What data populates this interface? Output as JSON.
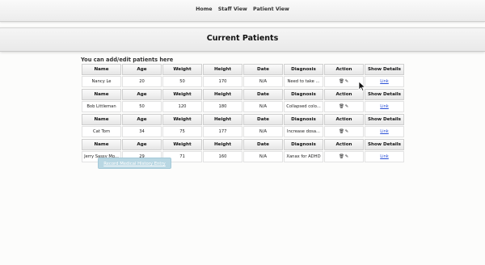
{
  "nav": {
    "home": "Home",
    "staff_view": "Staff View",
    "patient_view": "Patient View"
  },
  "page_title": "Current Patients",
  "subtitle": "You can add/edit patients here",
  "table_headers": [
    "Name",
    "Age",
    "Weight",
    "Height",
    "Date",
    "Diagnosis",
    "Action",
    "Show Details"
  ],
  "patients": [
    {
      "name": "Nancy Le",
      "age": "20",
      "weight": "50",
      "height": "170",
      "date": "N/A",
      "diagnosis": "Need to take ...",
      "action": "🗑✎",
      "details": "Link"
    },
    {
      "name": "Bob Littleman",
      "age": "50",
      "weight": "120",
      "height": "180",
      "date": "N/A",
      "diagnosis": "Collapsed colo...",
      "action": "🗑✎",
      "details": "Link"
    },
    {
      "name": "Cat Tom",
      "age": "34",
      "weight": "75",
      "height": "177",
      "date": "N/A",
      "diagnosis": "Increase dosa...",
      "action": "🗑✎",
      "details": "Link"
    },
    {
      "name": "Jerry Sassy Mo...",
      "age": "29",
      "weight": "71",
      "height": "160",
      "date": "N/A",
      "diagnosis": "Xanax for ADHD",
      "action": "🗑✎",
      "details": "Link"
    }
  ],
  "record_button": "Record Medical History Entry",
  "icons": {
    "delete": "trash-icon",
    "edit": "pencil-icon",
    "cursor": "mouse-pointer-icon"
  },
  "colors": {
    "button_bg": "#b9d7e3",
    "link": "#2a4fd6"
  }
}
